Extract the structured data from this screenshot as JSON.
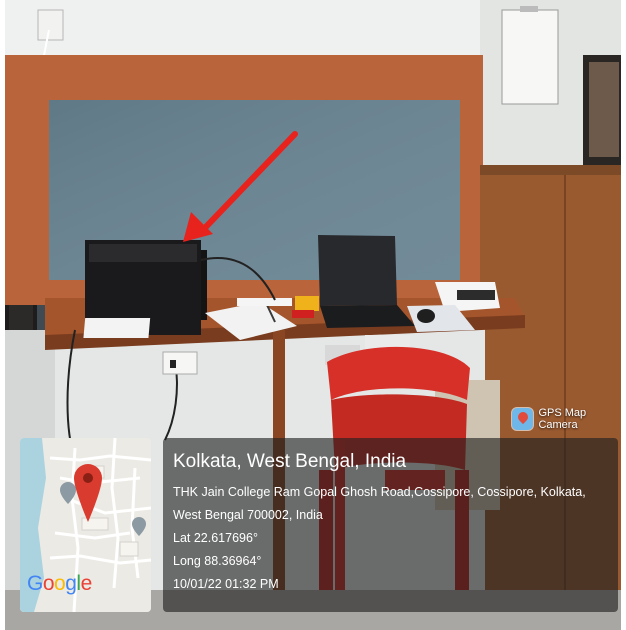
{
  "badge": {
    "app_name": "GPS Map Camera",
    "icon": "map-pin-icon"
  },
  "map": {
    "provider_logo": "Google",
    "pin_icon": "location-pin-icon",
    "pin_color": "#d93b2e"
  },
  "location": {
    "city": "Kolkata, West Bengal, India",
    "address_line1": "THK Jain College Ram Gopal Ghosh Road,Cossipore, Cossipore, Kolkata,",
    "address_line2": "West Bengal 700002, India",
    "latitude": "Lat 22.617696°",
    "longitude": "Long 88.36964°",
    "datetime": "10/01/22 01:32 PM"
  },
  "annotation": {
    "arrow_color": "#e8221c"
  }
}
